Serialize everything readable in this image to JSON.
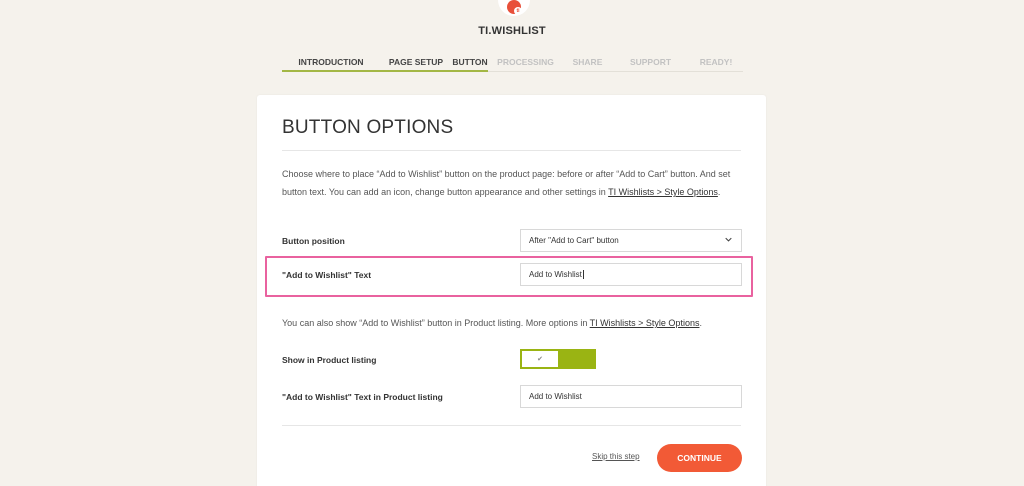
{
  "brand": "TI.WISHLIST",
  "steps": [
    {
      "label": "INTRODUCTION",
      "state": "done"
    },
    {
      "label": "PAGE SETUP",
      "state": "done"
    },
    {
      "label": "BUTTON",
      "state": "active"
    },
    {
      "label": "PROCESSING",
      "state": "pending"
    },
    {
      "label": "SHARE",
      "state": "pending"
    },
    {
      "label": "SUPPORT",
      "state": "pending"
    },
    {
      "label": "READY!",
      "state": "pending"
    }
  ],
  "card": {
    "title": "BUTTON OPTIONS",
    "desc_part1": "Choose where to place “Add to Wishlist” button on the product page: before or after “Add to Cart” button. And set button text. You can add an icon, change button appearance and other settings in ",
    "desc_link": "TI Wishlists > Style Options",
    "desc_part2": ".",
    "button_position_label": "Button position",
    "button_position_value": "After \"Add to Cart\" button",
    "wishlist_text_label": "\"Add to Wishlist\" Text",
    "wishlist_text_value": "Add to Wishlist",
    "note_part1": "You can also show “Add to Wishlist” button in Product listing. More options in ",
    "note_link": "TI Wishlists > Style Options",
    "note_part2": ".",
    "show_listing_label": "Show in Product listing",
    "show_listing_checkmark": "✔",
    "listing_text_label": "\"Add to Wishlist\" Text in Product listing",
    "listing_text_value": "Add to Wishlist",
    "skip_label": "Skip this step",
    "continue_label": "CONTINUE"
  },
  "colors": {
    "accent_green": "#9ab413",
    "accent_orange": "#f25a36",
    "highlight_pink": "#e9629f"
  }
}
